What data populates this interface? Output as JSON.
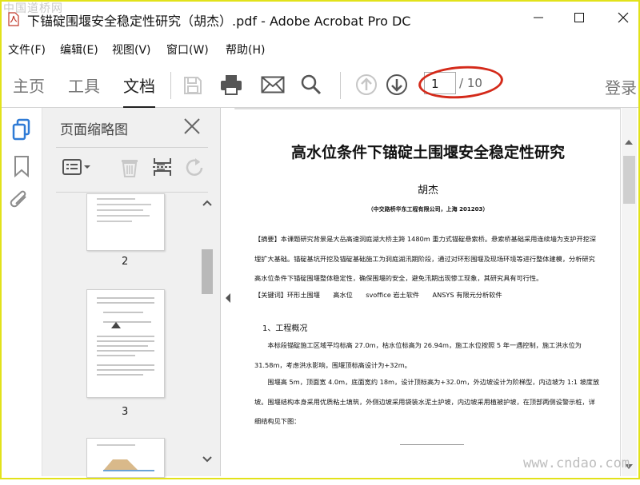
{
  "window": {
    "title": "下锚碇围堰安全稳定性研究（胡杰）.pdf - Adobe Acrobat Pro DC",
    "watermark_top": "中国道桥网",
    "watermark_bottom": "www.cndao.com"
  },
  "menu": [
    "文件(F)",
    "编辑(E)",
    "视图(V)",
    "窗口(W)",
    "帮助(H)"
  ],
  "toolbar": {
    "tabs": [
      "主页",
      "工具",
      "文档"
    ],
    "active_tab": "文档",
    "icons": [
      "save-icon",
      "print-icon",
      "email-icon",
      "search-icon",
      "page-up-icon",
      "page-down-icon"
    ],
    "current_page": "1",
    "page_count": "/ 10",
    "login": "登录"
  },
  "rail": {
    "icons": [
      "page-thumbnails-icon",
      "bookmark-icon",
      "attachment-icon"
    ]
  },
  "thumbnails_panel": {
    "title": "页面缩略图",
    "tools": [
      "options-menu-icon",
      "delete-icon",
      "insert-pages-icon",
      "rotate-icon"
    ],
    "pages": [
      "2",
      "3"
    ]
  },
  "document": {
    "title": "高水位条件下锚碇土围堰安全稳定性研究",
    "author": "胡杰",
    "affiliation": "（中交路桥华东工程有限公司，上海 201203）",
    "abstract": "【摘要】本课题研究背景是大岳高速洞庭湖大桥主跨 1480m 重力式锚碇悬索桥。悬索桥基础采用连续墙为支护开挖深埋扩大基础。锚碇基坑开挖及锚碇基础施工为洞庭湖汛期阶段，通过对环形围堰及现场环境等进行整体建模，分析研究高水位条件下锚碇围堰整体稳定性，确保围堰的安全，避免汛期出现惨工现象，其研究具有可行性。",
    "keywords": "【关键词】环形土围堰　　高水位　　svoffice 岩土软件　　ANSYS 有限元分析软件",
    "section_heading": "1、工程概况",
    "para1": "本标段锚碇施工区域平均标高 27.0m，枯水位标高为 26.94m，施工水位按照 5 年一遇控制，施工洪水位为 31.58m，考虑洪水影响，围堰顶标高设计为+32m。",
    "para2": "围堰高 5m，顶面宽 4.0m，底面宽约 18m，设计顶标高为+32.0m，外边坡设计为阶梯型，内边坡为 1:1 坡度放坡。围堰结构本身采用优质粘土填筑，外侧边坡采用袋装水泥土护坡，内边坡采用植被护坡，在顶部两侧设警示桩，详细结构见下图："
  },
  "colors": {
    "frame": "#e2e21a",
    "annotation": "#d42a1a",
    "panel_bg": "#f0f0f0",
    "accent_blue": "#2f7bd6"
  }
}
